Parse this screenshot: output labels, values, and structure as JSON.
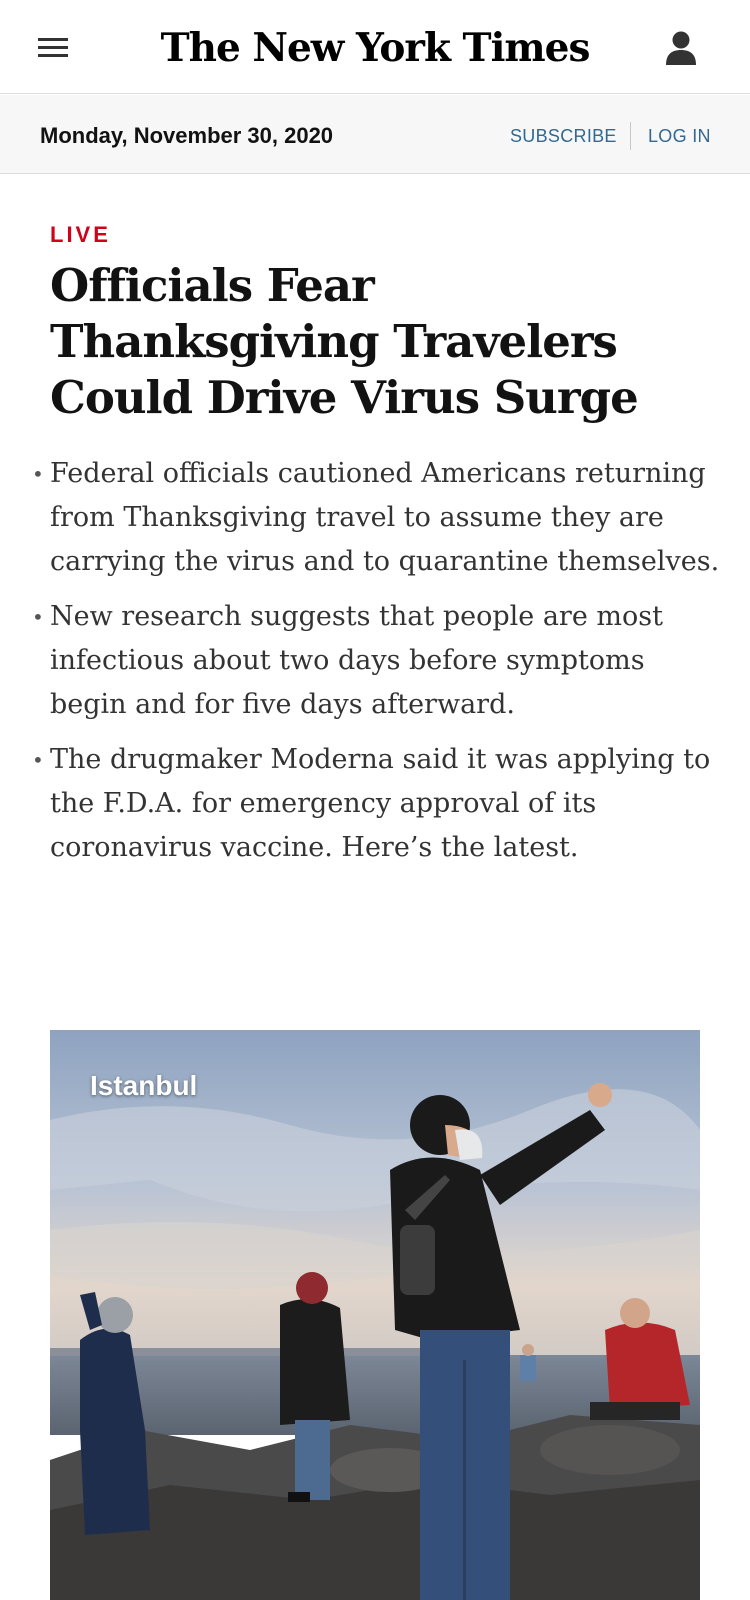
{
  "masthead": {
    "logo_text": "The New York Times",
    "menu_icon": "hamburger-menu-icon",
    "account_icon": "user-account-icon"
  },
  "date_bar": {
    "date": "Monday, November 30, 2020",
    "subscribe_label": "SUBSCRIBE",
    "login_label": "LOG IN"
  },
  "story": {
    "live_label": "LIVE",
    "headline": "Officials Fear Thanksgiving Travelers Could Drive Virus Surge",
    "bullets": [
      "Federal officials cautioned Americans returning from Thanksgiving travel to assume they are carrying the virus and to quarantine themselves.",
      "New research suggests that people are most infectious about two days before symptoms begin and for five days afterward.",
      "The drugmaker Moderna said it was applying to the F.D.A. for emergency approval of its coronavirus vaccine. Here’s the latest."
    ],
    "photo_caption": "Istanbul"
  },
  "colors": {
    "live_red": "#d0021b",
    "link_blue": "#326891",
    "date_bar_bg": "#f7f7f7"
  }
}
